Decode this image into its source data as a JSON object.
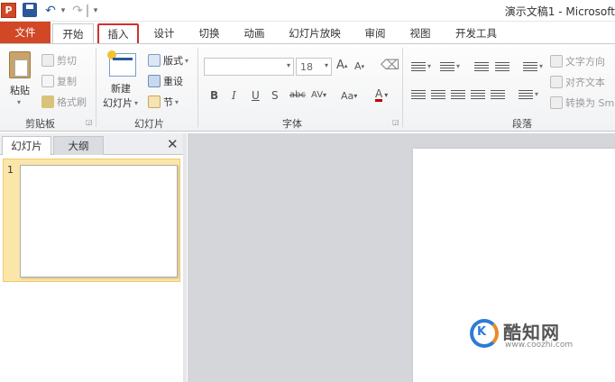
{
  "quick_access": {
    "app_letter": "P",
    "app_icon": "powerpoint-icon",
    "save_icon": "save-icon",
    "undo_icon": "undo-icon",
    "redo_icon": "redo-icon"
  },
  "window": {
    "title": "演示文稿1 - Microsoft"
  },
  "tabs": [
    {
      "label": "文件"
    },
    {
      "label": "开始"
    },
    {
      "label": "插入"
    },
    {
      "label": "设计"
    },
    {
      "label": "切换"
    },
    {
      "label": "动画"
    },
    {
      "label": "幻灯片放映"
    },
    {
      "label": "审阅"
    },
    {
      "label": "视图"
    },
    {
      "label": "开发工具"
    }
  ],
  "ribbon": {
    "clipboard": {
      "paste": "粘贴",
      "cut": "剪切",
      "copy": "复制",
      "format_painter": "格式刷",
      "group_label": "剪贴板"
    },
    "slides": {
      "new_slide_1": "新建",
      "new_slide_2": "幻灯片",
      "layout": "版式",
      "reset": "重设",
      "section": "节",
      "group_label": "幻灯片"
    },
    "font": {
      "size": "18",
      "grow": "A",
      "shrink": "A",
      "bold": "B",
      "italic": "I",
      "underline": "U",
      "strike": "S",
      "strikethrough": "abc",
      "spacing": "AV",
      "case": "Aa",
      "color": "A",
      "group_label": "字体"
    },
    "paragraph": {
      "text_direction": "文字方向",
      "align_text": "对齐文本",
      "convert_smartart": "转换为 Sm",
      "group_label": "段落"
    }
  },
  "left_panel": {
    "tab_slides": "幻灯片",
    "tab_outline": "大纲",
    "close_glyph": "✕",
    "thumbnail_number": "1"
  },
  "watermark": {
    "letter": "K",
    "name": "酷知网",
    "url": "www.coozhi.com"
  },
  "colors": {
    "file_tab": "#d24726",
    "highlight_border": "#d0312d",
    "selected_thumbnail": "#fbe6a9",
    "canvas_bg": "#d4d6d9"
  }
}
